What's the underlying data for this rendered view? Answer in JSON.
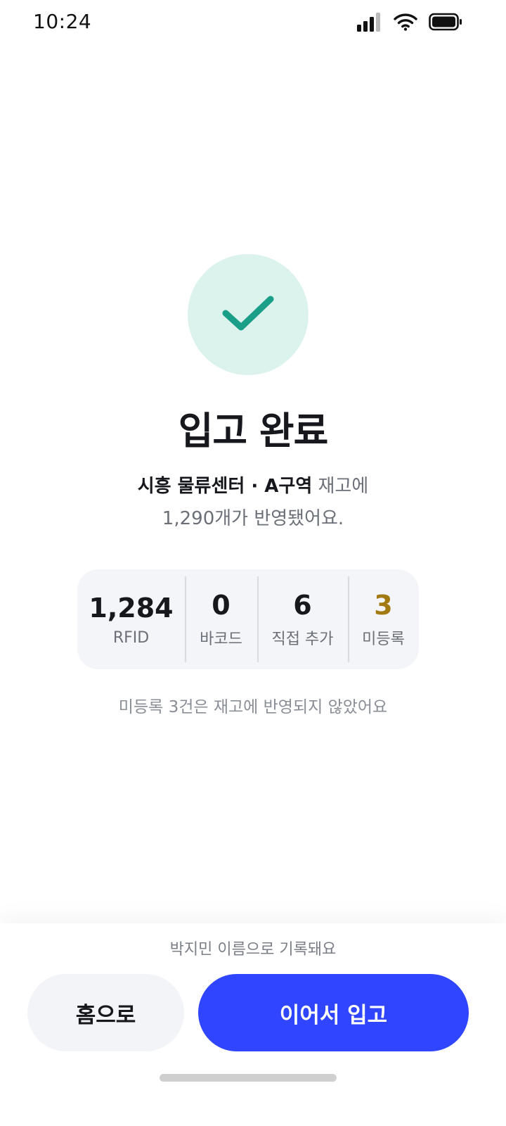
{
  "status_bar": {
    "time": "10:24",
    "icons": [
      "cellular-signal-icon",
      "wifi-icon",
      "battery-icon"
    ]
  },
  "success": {
    "icon": "checkmark-icon",
    "title": "입고 완료",
    "location": "시흥 물류센터 · A구역",
    "line1_suffix": " 재고에",
    "line2": "1,290개가 반영됐어요."
  },
  "stats": [
    {
      "value": "1,284",
      "label": "RFID"
    },
    {
      "value": "0",
      "label": "바코드"
    },
    {
      "value": "6",
      "label": "직접 추가"
    },
    {
      "value": "3",
      "label": "미등록"
    }
  ],
  "note": "미등록 3건은 재고에 반영되지 않았어요",
  "footer": {
    "record_note": "박지민 이름으로 기록돼요",
    "home_button": "홈으로",
    "continue_button": "이어서 입고"
  },
  "colors": {
    "primary": "#2f45ff",
    "success_bg": "#dbf2ed",
    "success_check": "#1a9e87",
    "warning_text": "#a37a12"
  }
}
